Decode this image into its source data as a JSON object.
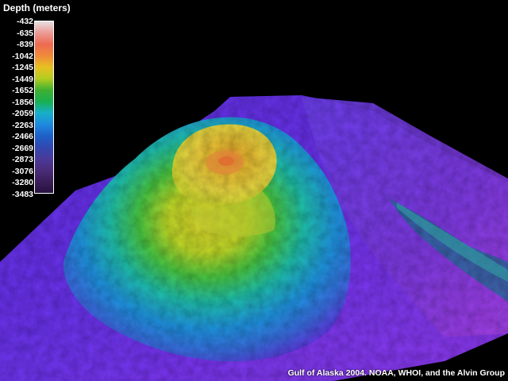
{
  "legend": {
    "title": "Depth (meters)",
    "labels": [
      "-432",
      "-635",
      "-839",
      "-1042",
      "-1245",
      "-1449",
      "-1652",
      "-1856",
      "-2059",
      "-2263",
      "-2466",
      "-2669",
      "-2873",
      "-3076",
      "-3280",
      "-3483"
    ],
    "colors": [
      "#e6e0e0",
      "#ec9a96",
      "#ee6a52",
      "#f08a3a",
      "#e8c020",
      "#b4cc20",
      "#40b030",
      "#18b050",
      "#18b0c8",
      "#1e8ae0",
      "#1e60c8",
      "#3048b0",
      "#4a3a9a",
      "#4a2c7a",
      "#3a1e5a",
      "#28123e"
    ]
  },
  "credit": "Gulf of Alaska 2004. NOAA, WHOI, and the Alvin Group",
  "scene": {
    "seafloor_color": "#6a2ee0",
    "background_color": "#000000"
  }
}
